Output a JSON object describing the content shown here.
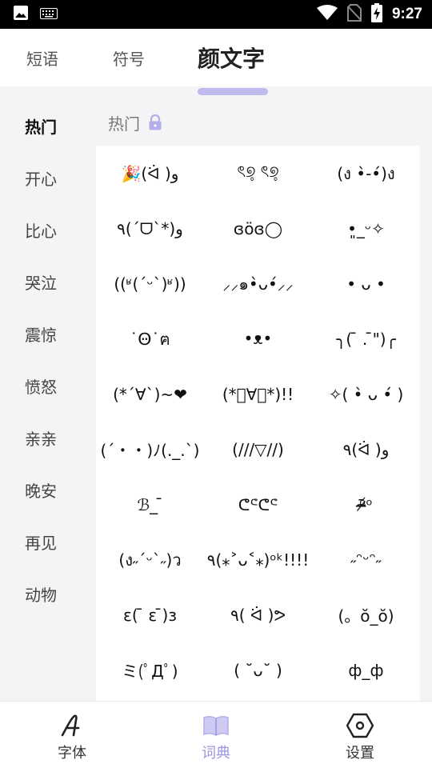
{
  "status_bar": {
    "time": "9:27",
    "icons": [
      "image-icon",
      "keyboard-icon",
      "wifi-icon",
      "no-sim-icon",
      "battery-charging-icon"
    ]
  },
  "top_tabs": [
    {
      "label": "短语"
    },
    {
      "label": "符号"
    },
    {
      "label": "颜文字",
      "selected": true
    }
  ],
  "sidebar": {
    "items": [
      "热门",
      "开心",
      "比心",
      "哭泣",
      "震惊",
      "愤怒",
      "亲亲",
      "晚安",
      "再见",
      "动物"
    ],
    "selected": "热门"
  },
  "section": {
    "title": "热门",
    "icon": "lock-icon"
  },
  "kaomoji": [
    "🎉(ᐛ )و",
    "ৎ୭̥ ৎ୭̥",
    "(ง •̀-•́)ง",
    "٩(ˊᗜˋ*)و",
    "ɞöɞ◯",
    "•͈_ᵕ✧",
    "((ʶ(´ᵕ`)ʶ))",
    "⸝⸝๑•̀ᴗ•́⸝⸝",
    "• ᴗ •",
    "˙Ꙫ˙ฅ",
    "•ᴥ•",
    "╮( ̄ . ̄\")╭",
    "(*´∀`)~❤",
    "(*ﾟ∀ﾟ*)!!",
    "✧( •̀ ᴗ •́ )",
    "(´・・)ﾉ(._.`)",
    "(///▽//)",
    "٩(ᐛ )و",
    "ℬ_ ̄",
    "ᕦᕪᕦᕪ",
    "ᵒ̴̶̷᷄ᵒ",
    "(ง˶ˊᵕˋ˶)ว",
    "٩(⁎˃ᴗ˂⁎)ᵒᵏ!!!!",
    "˶ᵔᵕᵔ˶",
    "ε( ̄ ε ̄)з",
    "٩( ᐛ )ᕗ",
    "(。ŏ_ŏ)",
    "ミ(ﾟДﾟ)",
    "( ˘ᴗ˘ )",
    "ф_ф"
  ],
  "bottom_nav": [
    {
      "label": "字体",
      "icon": "font-icon"
    },
    {
      "label": "词典",
      "icon": "book-icon",
      "selected": true
    },
    {
      "label": "设置",
      "icon": "settings-icon"
    }
  ],
  "colors": {
    "accent": "#9b95e0",
    "tab_highlight": "#bfbbee",
    "background": "#f4f4f6",
    "status_bar": "#000000"
  }
}
